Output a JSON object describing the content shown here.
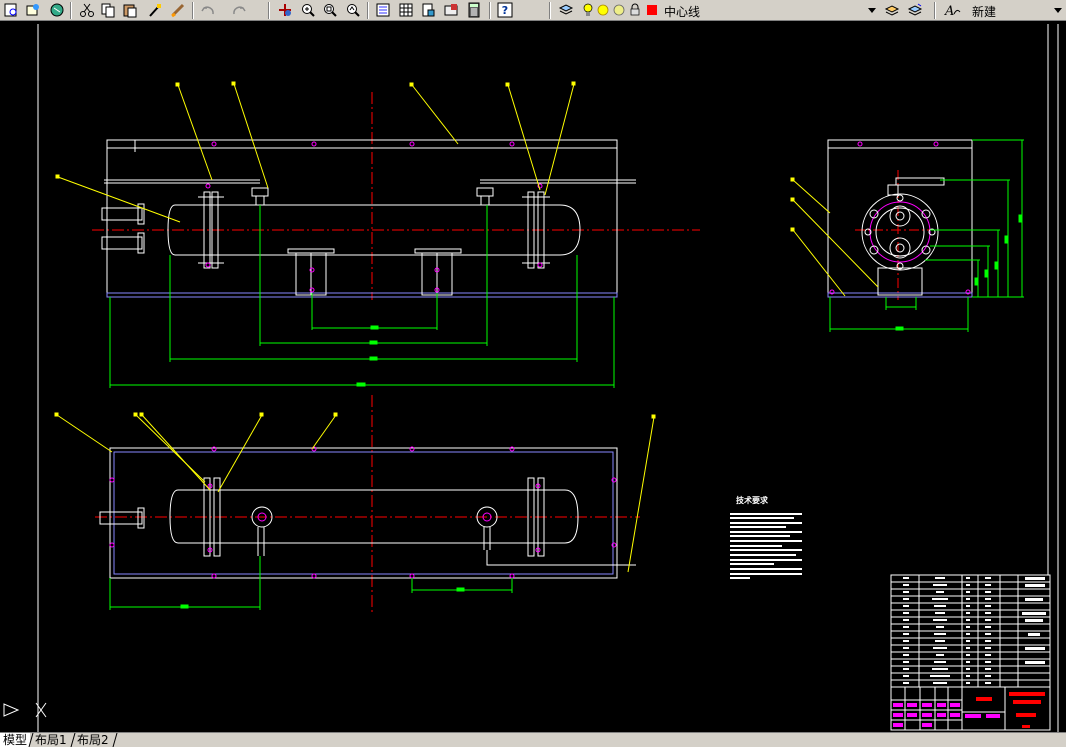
{
  "toolbar": {
    "buttons": [
      "zoom-preview-icon",
      "publish-icon",
      "plot-icon",
      "cut-icon",
      "copy-icon",
      "paste-icon",
      "match-properties-icon",
      "brush-icon",
      "undo-icon",
      "redo-icon",
      "pan-icon",
      "zoom-realtime-icon",
      "zoom-window-icon",
      "zoom-previous-icon",
      "properties-icon",
      "design-center-icon",
      "tool-palettes-icon",
      "sheet-set-icon",
      "calculator-icon",
      "help-icon",
      "layer-manager-icon",
      "layer-previous-icon"
    ],
    "layer_name": "中心线",
    "layer_color": "#ff0000",
    "text_style_name": "新建"
  },
  "drawing": {
    "technical_requirements_title": "技术要求",
    "colors": {
      "outline": "#ffffff",
      "dimension": "#00ff00",
      "centerline": "#ff0000",
      "leader": "#ffff00",
      "hidden": "#ff00ff"
    }
  },
  "tabs": [
    "模型",
    "布局1",
    "布局2"
  ]
}
